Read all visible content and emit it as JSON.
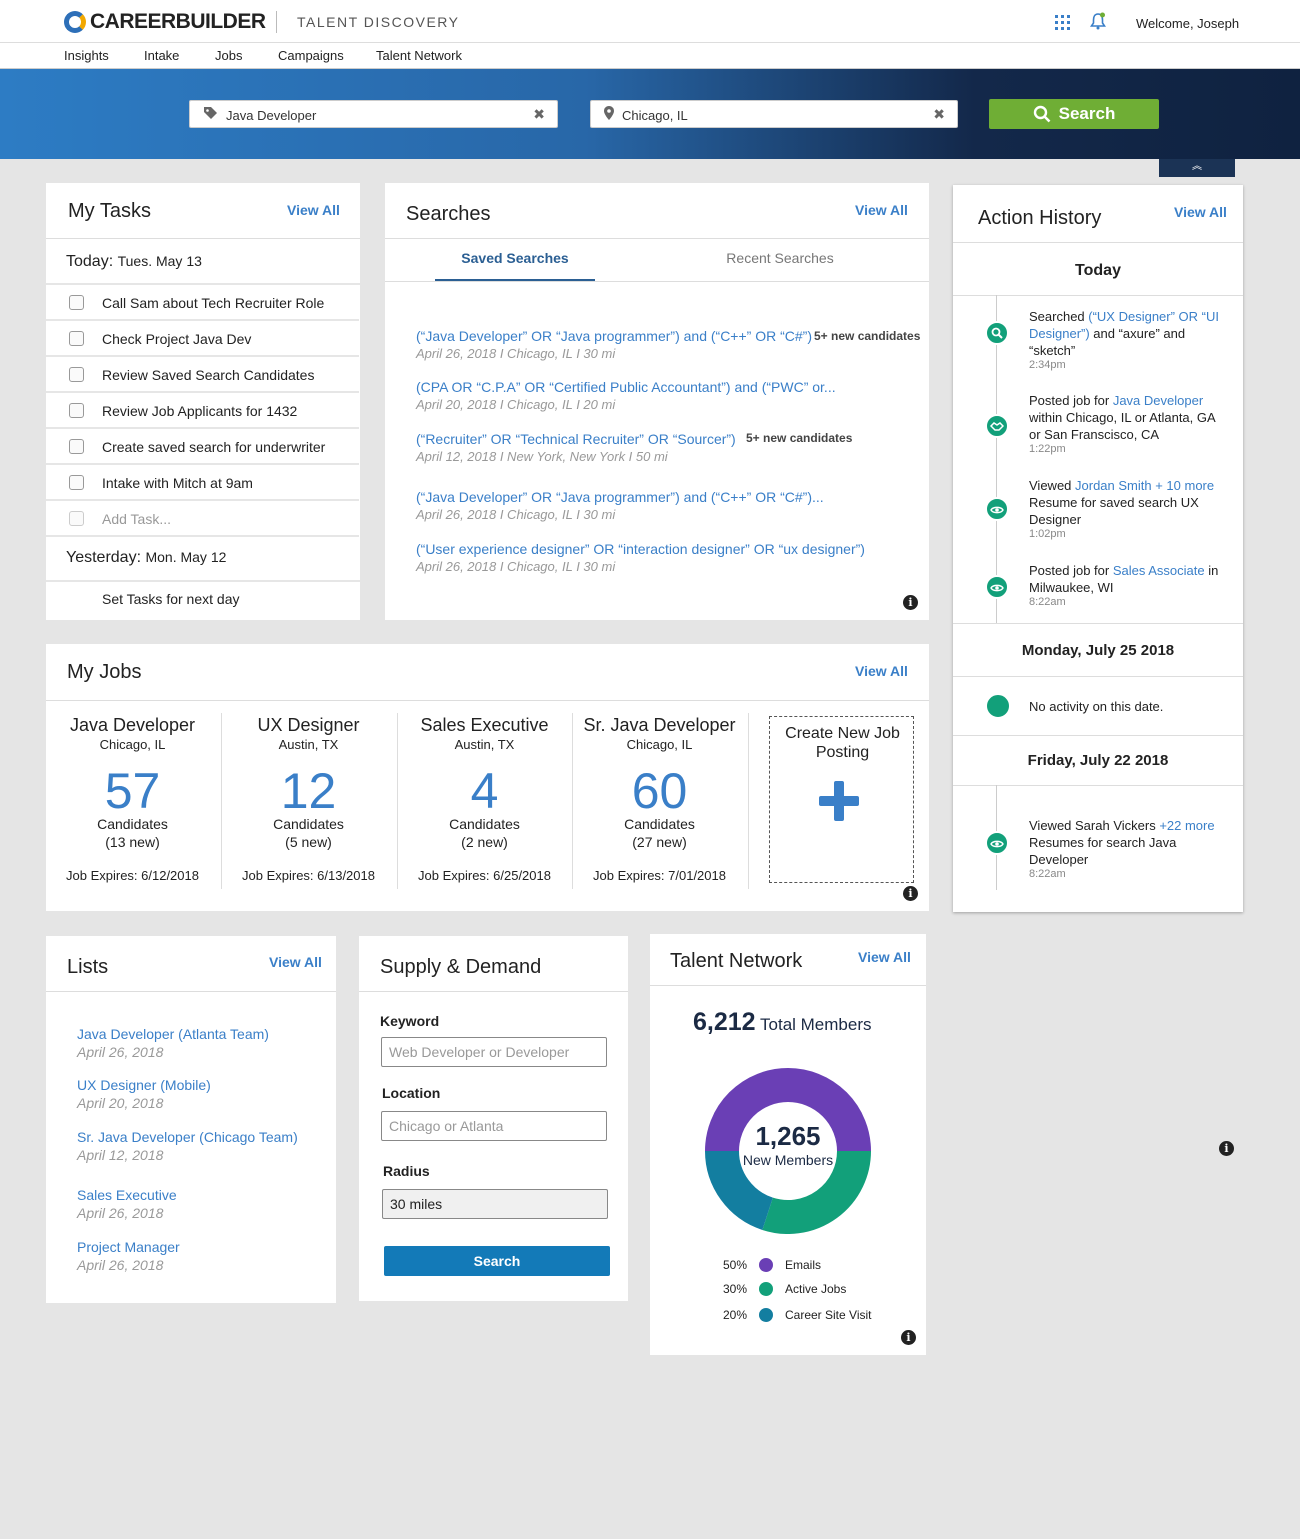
{
  "header": {
    "brand": "CAREERBUILDER",
    "product": "TALENT DISCOVERY",
    "welcome": "Welcome, Joseph"
  },
  "nav": [
    "Insights",
    "Intake",
    "Jobs",
    "Campaigns",
    "Talent Network"
  ],
  "search": {
    "keyword": "Java Developer",
    "location": "Chicago, IL",
    "button": "Search"
  },
  "tasks": {
    "title": "My Tasks",
    "view_all": "View All",
    "today_label": "Today:",
    "today_date": "Tues. May 13",
    "items": [
      "Call Sam about Tech Recruiter Role",
      "Check Project Java Dev",
      "Review Saved Search Candidates",
      "Review Job Applicants for 1432",
      "Create saved search for underwriter",
      "Intake with Mitch at 9am"
    ],
    "add_task": "Add Task...",
    "yesterday_label": "Yesterday:",
    "yesterday_date": "Mon. May 12",
    "set_tasks": "Set Tasks for next day"
  },
  "searches": {
    "title": "Searches",
    "view_all": "View All",
    "tabs": [
      "Saved Searches",
      "Recent Searches"
    ],
    "items": [
      {
        "query": "(“Java Developer” OR “Java programmer”) and (“C++” OR “C#”)",
        "meta": "April 26, 2018 I Chicago, IL I 30 mi",
        "badge": "5+ new candidates"
      },
      {
        "query": "(CPA OR “C.P.A” OR “Certified Public Accountant”) and (“PWC” or...",
        "meta": "April 20, 2018 I Chicago, IL I 20 mi",
        "badge": ""
      },
      {
        "query": "(“Recruiter” OR “Technical Recruiter” OR “Sourcer”)",
        "meta": "April 12, 2018 I New York, New York I 50 mi",
        "badge": "5+ new candidates"
      },
      {
        "query": "(“Java Developer” OR “Java programmer”) and (“C++” OR “C#”)...",
        "meta": "April 26, 2018 I Chicago, IL I 30 mi",
        "badge": ""
      },
      {
        "query": "(“User experience designer” OR “interaction designer” OR “ux designer”)",
        "meta": "April 26, 2018 I Chicago, IL I 30 mi",
        "badge": ""
      }
    ]
  },
  "jobs": {
    "title": "My Jobs",
    "view_all": "View All",
    "items": [
      {
        "name": "Java Developer",
        "location": "Chicago, IL",
        "count": "57",
        "candidates": "Candidates",
        "new": "(13 new)",
        "expires": "Job Expires: 6/12/2018"
      },
      {
        "name": "UX Designer",
        "location": "Austin, TX",
        "count": "12",
        "candidates": "Candidates",
        "new": "(5 new)",
        "expires": "Job Expires: 6/13/2018"
      },
      {
        "name": "Sales Executive",
        "location": "Austin, TX",
        "count": "4",
        "candidates": "Candidates",
        "new": "(2 new)",
        "expires": "Job Expires: 6/25/2018"
      },
      {
        "name": "Sr. Java Developer",
        "location": "Chicago, IL",
        "count": "60",
        "candidates": "Candidates",
        "new": "(27 new)",
        "expires": "Job Expires: 7/01/2018"
      }
    ],
    "create_new": "Create New Job Posting"
  },
  "action_history": {
    "title": "Action History",
    "view_all": "View All",
    "today": "Today",
    "today_items": [
      {
        "icon": "search-icon",
        "pre": "Searched ",
        "link": "(“UX Designer” OR “UI Designer”)",
        "post": " and “axure” and “sketch”",
        "time": "2:34pm"
      },
      {
        "icon": "handshake-icon",
        "pre": "Posted job for ",
        "link": "Java Developer",
        "post": " within Chicago, IL or Atlanta, GA or San Franscisco, CA",
        "time": "1:22pm"
      },
      {
        "icon": "eye-icon",
        "pre": "Viewed ",
        "link": "Jordan Smith + 10 more",
        "post": " Resume for saved search UX Designer",
        "time": "1:02pm"
      },
      {
        "icon": "eye-icon",
        "pre": "Posted job for ",
        "link": "Sales Associate",
        "post": " in Milwaukee, WI",
        "time": "8:22am"
      }
    ],
    "day2": "Monday, July 25 2018",
    "day2_text": "No activity on this date.",
    "day3": "Friday, July 22 2018",
    "day3_item": {
      "icon": "eye-icon",
      "pre": "Viewed Sarah Vickers ",
      "link": "+22 more",
      "post": " Resumes for search Java Developer",
      "time": "8:22am"
    }
  },
  "lists": {
    "title": "Lists",
    "view_all": "View All",
    "items": [
      {
        "name": "Java Developer (Atlanta Team)",
        "date": "April 26, 2018"
      },
      {
        "name": "UX Designer (Mobile)",
        "date": "April 20, 2018"
      },
      {
        "name": "Sr. Java Developer (Chicago Team)",
        "date": "April 12, 2018"
      },
      {
        "name": "Sales Executive",
        "date": "April 26, 2018"
      },
      {
        "name": "Project Manager",
        "date": "April 26, 2018"
      }
    ]
  },
  "supply_demand": {
    "title": "Supply & Demand",
    "keyword_label": "Keyword",
    "keyword_placeholder": "Web Developer or Developer",
    "location_label": "Location",
    "location_placeholder": "Chicago or Atlanta",
    "radius_label": "Radius",
    "radius_value": "30 miles",
    "button": "Search"
  },
  "talent_network": {
    "title": "Talent Network",
    "view_all": "View All",
    "total_value": "6,212",
    "total_label": "Total Members",
    "new_value": "1,265",
    "new_label": "New Members",
    "segments": [
      {
        "pct": "50%",
        "name": "Emails",
        "value": 50,
        "color": "#6a3fb5"
      },
      {
        "pct": "30%",
        "name": "Active Jobs",
        "value": 30,
        "color": "#12a07a"
      },
      {
        "pct": "20%",
        "name": "Career Site Visit",
        "value": 20,
        "color": "#137ea0"
      }
    ]
  }
}
